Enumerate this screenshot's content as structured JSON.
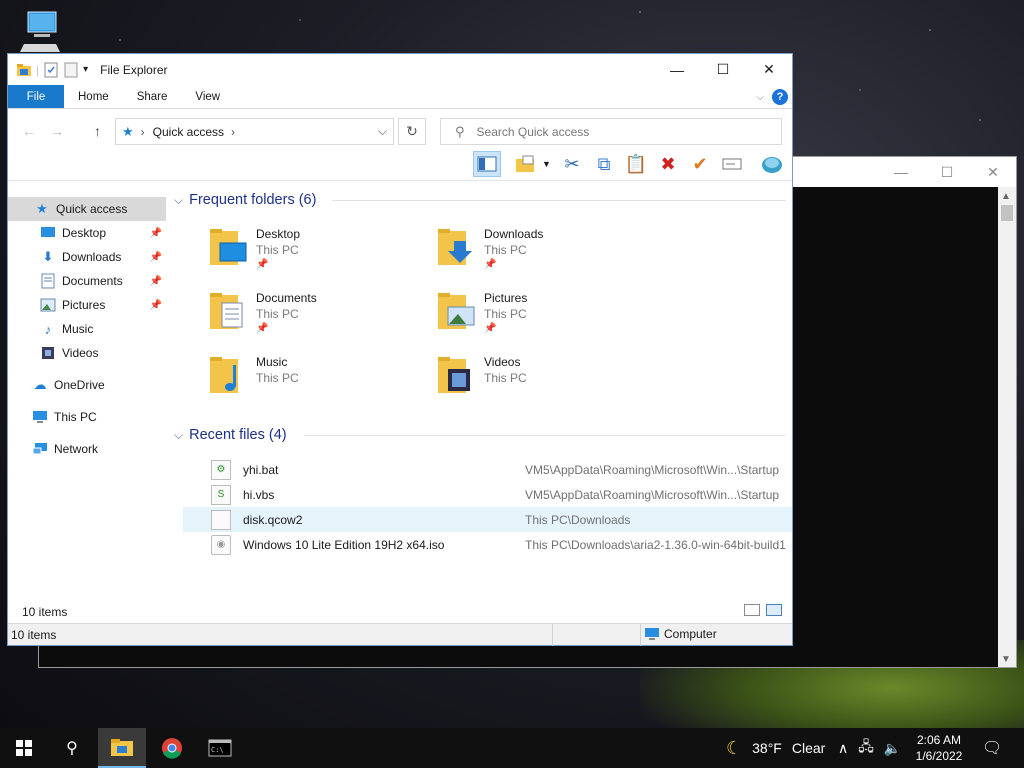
{
  "window": {
    "title": "File Explorer",
    "minimize": "—",
    "maximize": "☐",
    "close": "✕"
  },
  "ribbon": {
    "tabs": [
      "File",
      "Home",
      "Share",
      "View"
    ],
    "help": "?"
  },
  "address": {
    "crumb": "Quick access",
    "search_placeholder": "Search Quick access"
  },
  "nav_pane": {
    "items": [
      {
        "label": "Quick access",
        "icon": "star-icon"
      },
      {
        "label": "Desktop",
        "icon": "desktop-icon",
        "pinned": true
      },
      {
        "label": "Downloads",
        "icon": "download-icon",
        "pinned": true
      },
      {
        "label": "Documents",
        "icon": "document-icon",
        "pinned": true
      },
      {
        "label": "Pictures",
        "icon": "pictures-icon",
        "pinned": true
      },
      {
        "label": "Music",
        "icon": "music-icon"
      },
      {
        "label": "Videos",
        "icon": "videos-icon"
      },
      {
        "label": "OneDrive",
        "icon": "cloud-icon"
      },
      {
        "label": "This PC",
        "icon": "computer-icon"
      },
      {
        "label": "Network",
        "icon": "network-icon"
      }
    ]
  },
  "frequent": {
    "header": "Frequent folders (6)",
    "folders": [
      {
        "name": "Desktop",
        "location": "This PC"
      },
      {
        "name": "Downloads",
        "location": "This PC"
      },
      {
        "name": "Documents",
        "location": "This PC"
      },
      {
        "name": "Pictures",
        "location": "This PC"
      },
      {
        "name": "Music",
        "location": "This PC"
      },
      {
        "name": "Videos",
        "location": "This PC"
      }
    ]
  },
  "recent": {
    "header": "Recent files (4)",
    "files": [
      {
        "name": "yhi.bat",
        "path": "VM5\\AppData\\Roaming\\Microsoft\\Win...\\Startup"
      },
      {
        "name": "hi.vbs",
        "path": "VM5\\AppData\\Roaming\\Microsoft\\Win...\\Startup"
      },
      {
        "name": "disk.qcow2",
        "path": "This PC\\Downloads"
      },
      {
        "name": "Windows 10 Lite Edition 19H2 x64.iso",
        "path": "This PC\\Downloads\\aria2-1.36.0-win-64bit-build1"
      }
    ]
  },
  "status": {
    "item_count": "10 items",
    "bar_count": "10 items",
    "computer": "Computer"
  },
  "taskbar": {
    "weather_temp": "38°F",
    "weather_desc": "Clear",
    "time": "2:06 AM",
    "date": "1/6/2022"
  },
  "colors": {
    "accent": "#1979ca",
    "group_header": "#1e3287",
    "selection": "#e5f3fb"
  }
}
